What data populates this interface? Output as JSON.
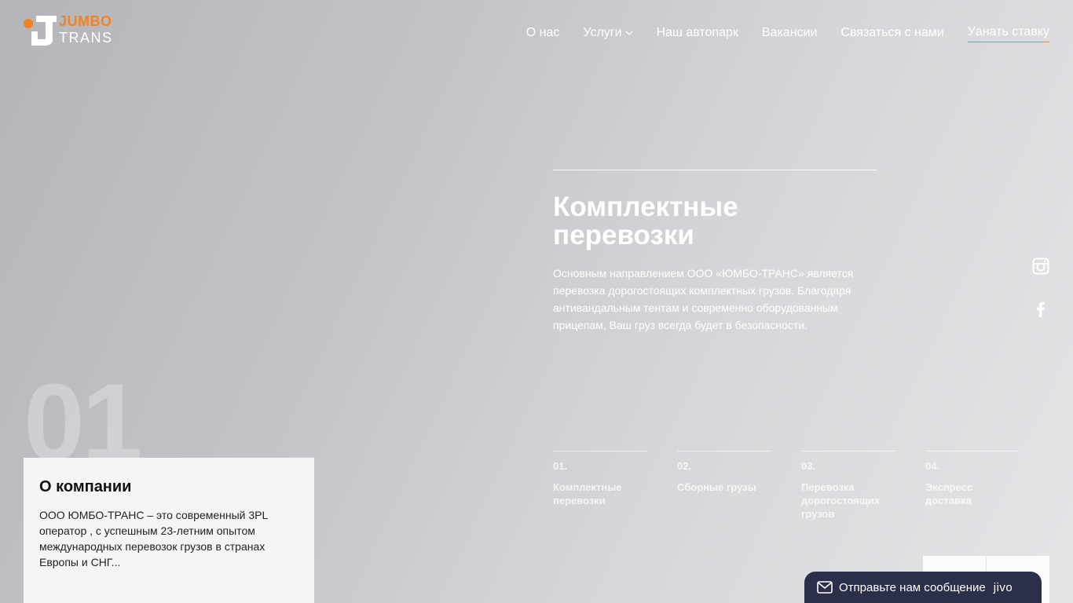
{
  "header": {
    "logo_top": "JUMBO",
    "logo_bottom": "TRANS",
    "nav": [
      {
        "label": "О нас"
      },
      {
        "label": "Услуги"
      },
      {
        "label": "Наш автопарк"
      },
      {
        "label": "Вакансии"
      },
      {
        "label": "Связаться с нами"
      },
      {
        "label": "Уанать ставку"
      }
    ]
  },
  "hero": {
    "title": "Комплектные перевозки",
    "text": "Основным направлением ООО «ЮМБО-ТРАНС» является перевозка дорогостоящих комплектных грузов. Благодаря антивандальным тентам и современно оборудованным прицепам, Ваш груз всегда будет в безопасности."
  },
  "social": {
    "icons": [
      "instagram-icon",
      "facebook-icon"
    ]
  },
  "big_number": "01",
  "about": {
    "title": "О компании",
    "text": "ООО ЮМБО-ТРАНС – это современный 3PL оператор , с успешным 23-летним опытом международных перевозок грузов в странах Европы и СНГ..."
  },
  "slides": [
    {
      "num": "01.",
      "label": "Комплектные перевозки"
    },
    {
      "num": "02.",
      "label": "Сборные грузы"
    },
    {
      "num": "03.",
      "label": "Перевозка дорогостоящих грузов"
    },
    {
      "num": "04.",
      "label": "Экспресс доставка"
    }
  ],
  "chat": {
    "label": "Отправьте нам сообщение",
    "brand": "jivo"
  },
  "colors": {
    "accent": "#f58220",
    "chat_bg": "#2b2f49"
  }
}
